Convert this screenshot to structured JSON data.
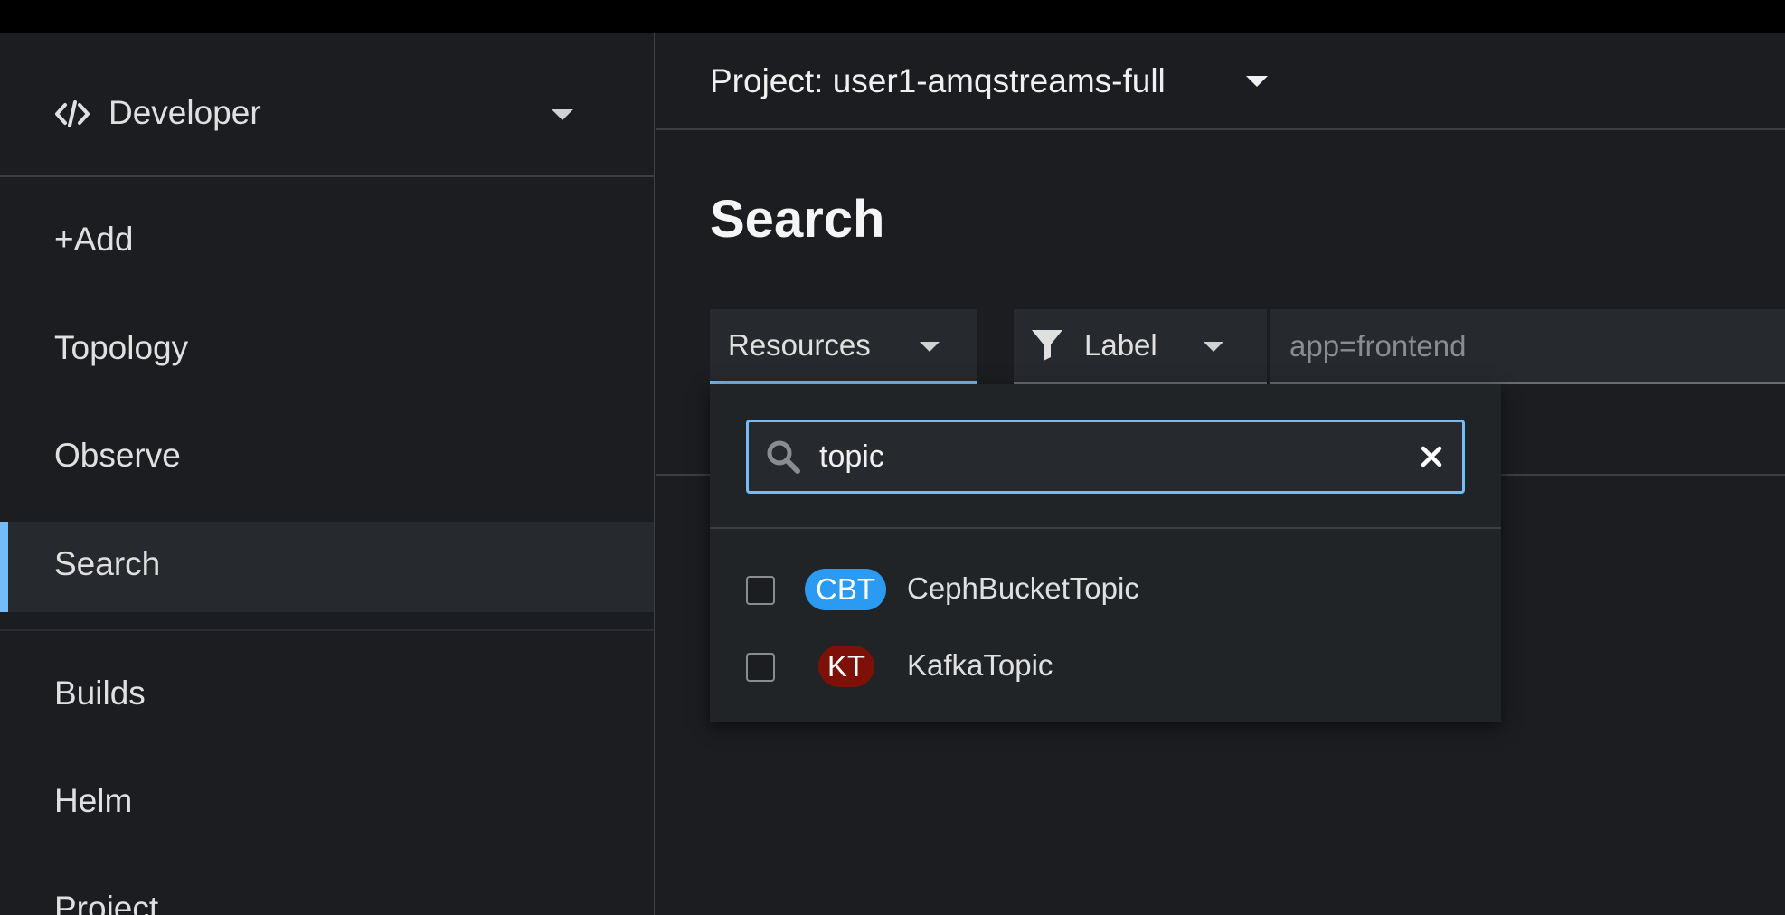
{
  "perspective": {
    "label": "Developer",
    "icon": "code-icon"
  },
  "nav": {
    "items": [
      {
        "label": "+Add"
      },
      {
        "label": "Topology"
      },
      {
        "label": "Observe"
      },
      {
        "label": "Search",
        "active": true
      },
      {
        "label": "Builds"
      },
      {
        "label": "Helm"
      },
      {
        "label": "Project"
      }
    ]
  },
  "project": {
    "label": "Project: user1-amqstreams-full"
  },
  "page": {
    "title": "Search"
  },
  "toolbar": {
    "resources_label": "Resources",
    "label_filter_label": "Label",
    "label_input_placeholder": "app=frontend"
  },
  "dropdown": {
    "search_value": "topic",
    "options": [
      {
        "badge": "CBT",
        "label": "CephBucketTopic",
        "badge_color": "#2b9af3",
        "checked": false
      },
      {
        "badge": "KT",
        "label": "KafkaTopic",
        "badge_color": "#7d1007",
        "checked": false
      }
    ]
  },
  "colors": {
    "accent": "#73bcf7",
    "background": "#1b1d21",
    "topbar": "#000000"
  }
}
